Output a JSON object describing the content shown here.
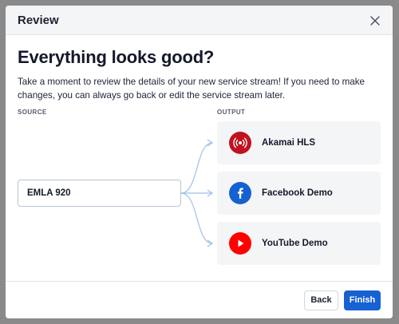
{
  "modal": {
    "title": "Review",
    "headline": "Everything looks good?",
    "description": "Take a moment to review the details of your new service stream! If you need to make changes, you can always go back or edit the service stream later."
  },
  "columns": {
    "source_label": "SOURCE",
    "output_label": "OUTPUT"
  },
  "source": {
    "name": "EMLA 920"
  },
  "outputs": [
    {
      "name": "Akamai HLS",
      "icon": "broadcast-icon",
      "color": "#c1121f"
    },
    {
      "name": "Facebook Demo",
      "icon": "facebook-icon",
      "color": "#1561d1"
    },
    {
      "name": "YouTube Demo",
      "icon": "youtube-icon",
      "color": "#ff0000"
    }
  ],
  "footer": {
    "back_label": "Back",
    "finish_label": "Finish"
  },
  "colors": {
    "primary": "#1662d3",
    "connector": "#9fc1e6"
  }
}
